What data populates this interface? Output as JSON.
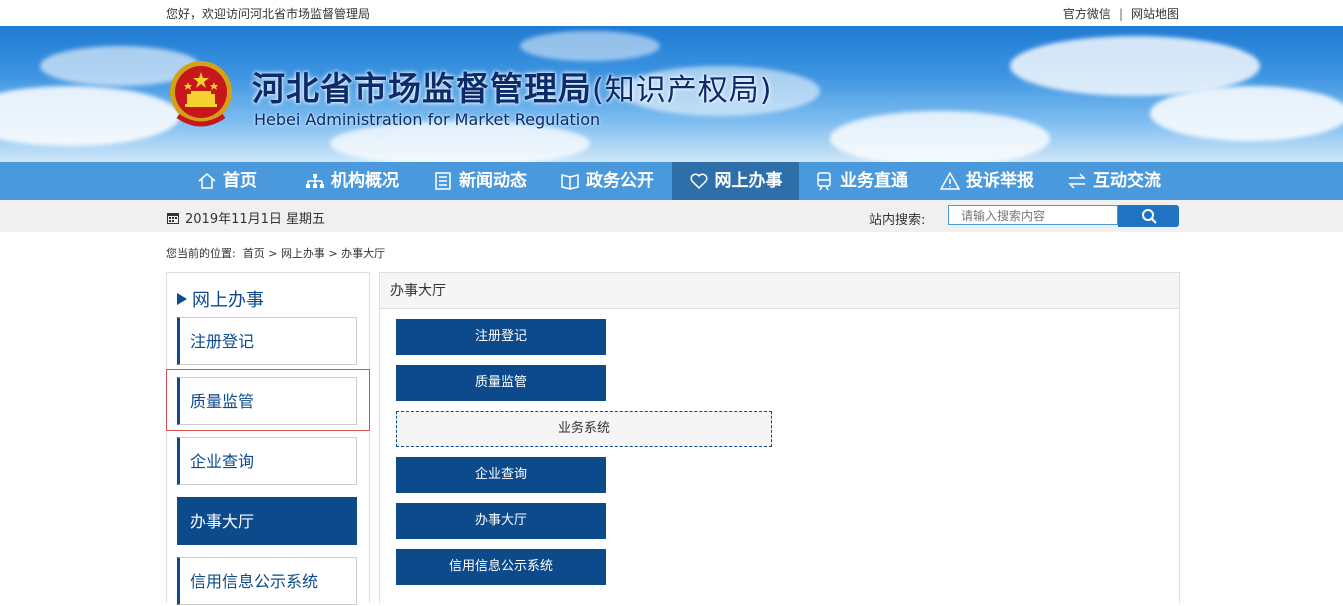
{
  "topbar": {
    "welcome": "您好，欢迎访问河北省市场监督管理局",
    "wechat": "官方微信",
    "separator": "|",
    "sitemap": "网站地图"
  },
  "header": {
    "title": "河北省市场监督管理局",
    "title_suffix": "(知识产权局)",
    "subtitle_en": "Hebei Administration for Market Regulation"
  },
  "nav": {
    "items": [
      {
        "label": "首页",
        "icon": "home-icon"
      },
      {
        "label": "机构概况",
        "icon": "org-chart-icon"
      },
      {
        "label": "新闻动态",
        "icon": "news-icon"
      },
      {
        "label": "政务公开",
        "icon": "open-book-icon"
      },
      {
        "label": "网上办事",
        "icon": "heart-icon",
        "active": true
      },
      {
        "label": "业务直通",
        "icon": "train-icon"
      },
      {
        "label": "投诉举报",
        "icon": "warning-icon"
      },
      {
        "label": "互动交流",
        "icon": "exchange-icon"
      }
    ]
  },
  "datebar": {
    "date": "2019年11月1日 星期五",
    "search_label": "站内搜索:",
    "search_placeholder": "请输入搜索内容"
  },
  "breadcrumb": {
    "prefix": "您当前的位置:",
    "items": [
      "首页",
      "网上办事",
      "办事大厅"
    ],
    "separator": ">"
  },
  "sidebar": {
    "title": "网上办事",
    "items": [
      {
        "label": "注册登记"
      },
      {
        "label": "质量监管"
      },
      {
        "label": "企业查询"
      },
      {
        "label": "办事大厅",
        "active": true
      },
      {
        "label": "信用信息公示系统"
      }
    ]
  },
  "content": {
    "title": "办事大厅",
    "buttons": [
      {
        "label": "注册登记"
      },
      {
        "label": "质量监管"
      },
      {
        "label": "业务系统"
      },
      {
        "label": "企业查询"
      },
      {
        "label": "办事大厅"
      },
      {
        "label": "信用信息公示系统"
      }
    ]
  },
  "colors": {
    "nav_bg": "#4a99dc",
    "nav_active": "#2f6fa9",
    "primary": "#0d4a8c",
    "highlight_box": "#d9534f"
  }
}
